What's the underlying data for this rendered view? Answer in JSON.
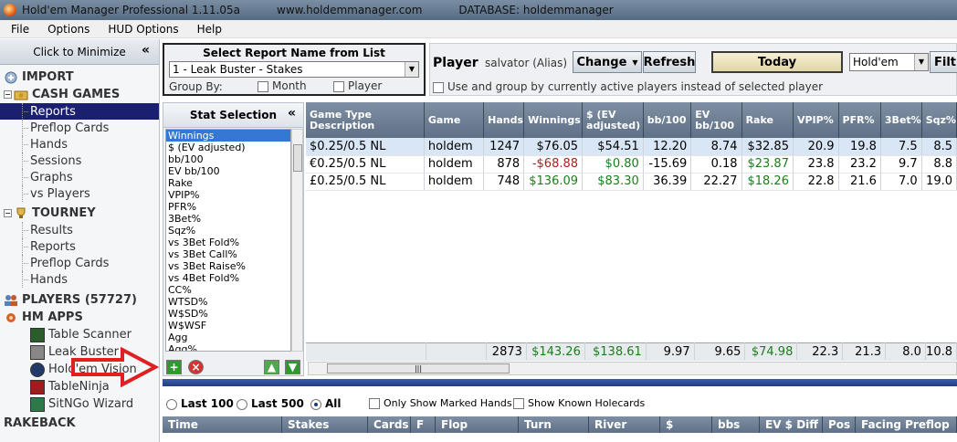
{
  "window": {
    "title": "Hold'em Manager Professional 1.11.05a",
    "url": "www.holdemmanager.com",
    "database": "DATABASE: holdemmanager"
  },
  "menu": [
    "File",
    "Options",
    "HUD Options",
    "Help"
  ],
  "nav": {
    "minimize_label": "Click to Minimize",
    "import": "IMPORT",
    "cash_games": "CASH GAMES",
    "cash_items": [
      "Reports",
      "Preflop Cards",
      "Hands",
      "Sessions",
      "Graphs",
      "vs Players"
    ],
    "tourney": "TOURNEY",
    "tourney_items": [
      "Results",
      "Reports",
      "Preflop Cards",
      "Hands"
    ],
    "players": "PLAYERS (57727)",
    "hm_apps": "HM APPS",
    "apps": [
      "Table Scanner",
      "Leak Buster",
      "Hold'em Vision",
      "TableNinja",
      "SitNGo Wizard"
    ],
    "rakeback": "RAKEBACK"
  },
  "report": {
    "title": "Select Report Name from List",
    "selected": "1 - Leak Buster - Stakes",
    "group_by": "Group By:",
    "month": "Month",
    "player": "Player"
  },
  "player_bar": {
    "label": "Player",
    "name": "salvator (Alias)",
    "change": "Change",
    "refresh": "Refresh",
    "today": "Today",
    "game": "Hold'em",
    "filter": "Filt",
    "use_active": "Use and group by currently active players instead of selected player"
  },
  "stat_selection": {
    "title": "Stat Selection",
    "items": [
      "Winnings",
      "$ (EV adjusted)",
      "bb/100",
      "EV bb/100",
      "Rake",
      "VPIP%",
      "PFR%",
      "3Bet%",
      "Sqz%",
      "vs 3Bet Fold%",
      "vs 3Bet Call%",
      "vs 3Bet Raise%",
      "vs 4Bet Fold%",
      "CC%",
      "WTSD%",
      "W$SD%",
      "W$WSF",
      "Agg",
      "Agg%"
    ]
  },
  "table": {
    "headers": [
      "Game Type Description",
      "Game",
      "Hands",
      "Winnings",
      "$ (EV adjusted)",
      "bb/100",
      "EV bb/100",
      "Rake",
      "VPIP%",
      "PFR%",
      "3Bet%",
      "Sqz%"
    ],
    "rows": [
      [
        "$0.25/0.5 NL",
        "holdem",
        "1247",
        "$76.05",
        "$54.51",
        "12.20",
        "8.74",
        "$32.85",
        "20.9",
        "19.8",
        "7.5",
        "8.5"
      ],
      [
        "€0.25/0.5 NL",
        "holdem",
        "878",
        "-$68.88",
        "$0.80",
        "-15.69",
        "0.18",
        "$23.87",
        "23.8",
        "23.2",
        "9.7",
        "8.8"
      ],
      [
        "£0.25/0.5 NL",
        "holdem",
        "748",
        "$136.09",
        "$83.30",
        "36.39",
        "22.27",
        "$18.26",
        "22.8",
        "21.6",
        "7.0",
        "19.0"
      ]
    ],
    "totals": [
      "",
      "",
      "2873",
      "$143.26",
      "$138.61",
      "9.97",
      "9.65",
      "$74.98",
      "22.3",
      "21.3",
      "8.0",
      "10.8"
    ]
  },
  "hands_filter": {
    "last100": "Last 100",
    "last500": "Last 500",
    "all": "All",
    "marked": "Only Show Marked Hands",
    "known": "Show Known Holecards"
  },
  "hands_headers": [
    "Time",
    "Stakes",
    "Cards",
    "F",
    "Flop",
    "Turn",
    "River",
    "$",
    "bbs",
    "EV $ Diff",
    "Pos",
    "Facing Preflop"
  ],
  "colors": {
    "selected_nav": "#1a1f70",
    "header_grid": "#6d7e93",
    "win_green": "#1b7d1b",
    "loss_red": "#b02020",
    "arrow": "#e02020"
  }
}
